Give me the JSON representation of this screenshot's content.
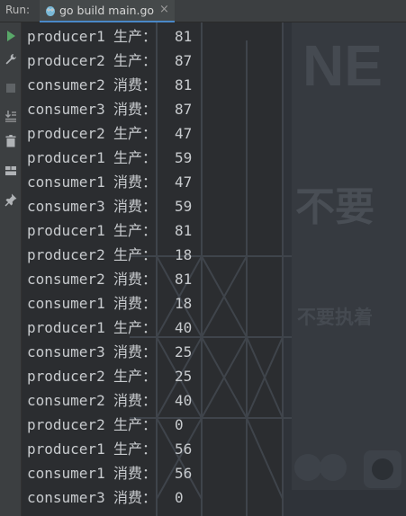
{
  "header": {
    "run_label": "Run:",
    "tab_label": "go build main.go",
    "tab_close": "×",
    "tab_icon": "gopher-icon"
  },
  "toolbar": {
    "buttons": [
      "run-icon",
      "wrench-icon",
      "stop-icon",
      "scroll-to-end-icon",
      "delete-icon",
      "layout-icon",
      "pin-icon"
    ]
  },
  "background_art": {
    "text_large_1": "NE",
    "text_large_2": "不要",
    "text_medium": "不要执着"
  },
  "console": {
    "lines": [
      {
        "who": "producer1",
        "action": "生产：",
        "value": "81"
      },
      {
        "who": "producer2",
        "action": "生产：",
        "value": "87"
      },
      {
        "who": "consumer2",
        "action": "消费：",
        "value": "81"
      },
      {
        "who": "consumer3",
        "action": "消费：",
        "value": "87"
      },
      {
        "who": "producer2",
        "action": "生产：",
        "value": "47"
      },
      {
        "who": "producer1",
        "action": "生产：",
        "value": "59"
      },
      {
        "who": "consumer1",
        "action": "消费：",
        "value": "47"
      },
      {
        "who": "consumer3",
        "action": "消费：",
        "value": "59"
      },
      {
        "who": "producer1",
        "action": "生产：",
        "value": "81"
      },
      {
        "who": "producer2",
        "action": "生产：",
        "value": "18"
      },
      {
        "who": "consumer2",
        "action": "消费：",
        "value": "81"
      },
      {
        "who": "consumer1",
        "action": "消费：",
        "value": "18"
      },
      {
        "who": "producer1",
        "action": "生产：",
        "value": "40"
      },
      {
        "who": "consumer3",
        "action": "消费：",
        "value": "25"
      },
      {
        "who": "producer2",
        "action": "生产：",
        "value": "25"
      },
      {
        "who": "consumer2",
        "action": "消费：",
        "value": "40"
      },
      {
        "who": "producer2",
        "action": "生产：",
        "value": "0"
      },
      {
        "who": "producer1",
        "action": "生产：",
        "value": "56"
      },
      {
        "who": "consumer1",
        "action": "消费：",
        "value": "56"
      },
      {
        "who": "consumer3",
        "action": "消费：",
        "value": "0"
      }
    ]
  }
}
